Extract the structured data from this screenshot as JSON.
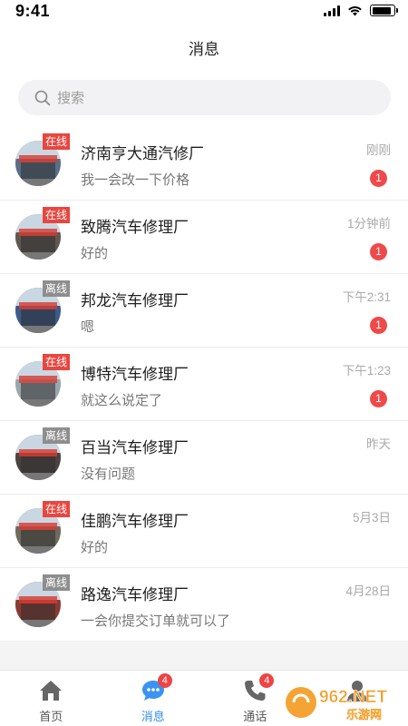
{
  "status_bar": {
    "time": "9:41",
    "battery_level": 0.9
  },
  "header": {
    "title": "消息"
  },
  "search": {
    "placeholder": "搜索"
  },
  "chats": [
    {
      "name": "济南亨大通汽修厂",
      "last_message": "我一会改一下价格",
      "time": "刚刚",
      "status": "在线",
      "online": true,
      "unread": "1",
      "avatar_color": "#5a6f86"
    },
    {
      "name": "致腾汽车修理厂",
      "last_message": "好的",
      "time": "1分钟前",
      "status": "在线",
      "online": true,
      "unread": "1",
      "avatar_color": "#5f5750"
    },
    {
      "name": "邦龙汽车修理厂",
      "last_message": "嗯",
      "time": "下午2:31",
      "status": "离线",
      "online": false,
      "unread": "1",
      "avatar_color": "#3b5a8c"
    },
    {
      "name": "博特汽车修理厂",
      "last_message": "就这么说定了",
      "time": "下午1:23",
      "status": "在线",
      "online": true,
      "unread": "1",
      "avatar_color": "#9aa6ad"
    },
    {
      "name": "百当汽车修理厂",
      "last_message": "没有问题",
      "time": "昨天",
      "status": "离线",
      "online": false,
      "unread": "",
      "avatar_color": "#4a4340"
    },
    {
      "name": "佳鹏汽车修理厂",
      "last_message": "好的",
      "time": "5月3日",
      "status": "在线",
      "online": true,
      "unread": "",
      "avatar_color": "#6f6a5e"
    },
    {
      "name": "路逸汽车修理厂",
      "last_message": "一会你提交订单就可以了",
      "time": "4月28日",
      "status": "离线",
      "online": false,
      "unread": "",
      "avatar_color": "#8a3a32"
    }
  ],
  "tabs": [
    {
      "label": "首页",
      "icon": "home-icon",
      "badge": "",
      "active": false
    },
    {
      "label": "消息",
      "icon": "message-bubble-icon",
      "badge": "4",
      "active": true
    },
    {
      "label": "通话",
      "icon": "phone-icon",
      "badge": "4",
      "active": false
    },
    {
      "label": "",
      "icon": "profile-icon",
      "badge": "",
      "active": false
    }
  ],
  "colors": {
    "accent": "#2f8cf0",
    "online": "#e8463f",
    "offline": "#8e8e8e",
    "unread": "#ee4a4a"
  },
  "watermark": {
    "text": "962.NET",
    "subtext": "乐游网"
  }
}
